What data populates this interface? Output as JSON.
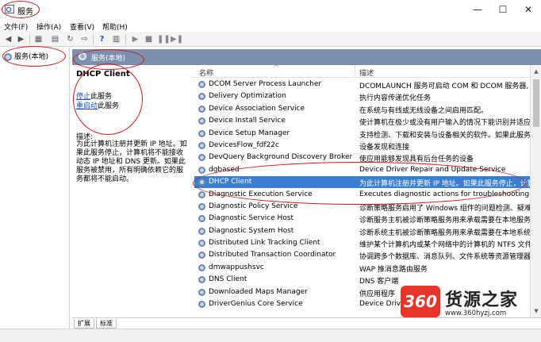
{
  "window": {
    "title": "服务",
    "controls": {
      "minimize": "—",
      "maximize": "☐",
      "close": "✕"
    }
  },
  "menu": {
    "items": [
      "文件(F)",
      "操作(A)",
      "查看(V)",
      "帮助(H)"
    ]
  },
  "tree": {
    "root_label": "服务(本地)"
  },
  "panel": {
    "header": "服务(本地)"
  },
  "description": {
    "service_name": "DHCP Client",
    "stop_link": "停止",
    "stop_suffix": "此服务",
    "restart_link": "重启动",
    "restart_suffix": "此服务",
    "label": "描述:",
    "text": "为此计算机注册并更新 IP 地址。如果此服务停止，计算机将不能接收动态 IP 地址和 DNS 更新。如果此服务被禁用，所有明确依赖它的服务都将不能启动。"
  },
  "list": {
    "columns": {
      "name": "名称",
      "description": "描述",
      "sort_indicator": "^"
    },
    "rows": [
      {
        "name": "DCOM Server Process Launcher",
        "info": "DCOMLAUNCH 服务可启动 COM 和 DCOM 服务器,",
        "selected": false
      },
      {
        "name": "Delivery Optimization",
        "info": "执行内容传递优化任务",
        "selected": false
      },
      {
        "name": "Device Association Service",
        "info": "在系统与有线或无线设备之间启用匹配。",
        "selected": false
      },
      {
        "name": "Device Install Service",
        "info": "使计算机在极少或没有用户输入的情况下能识别并适应硬",
        "selected": false
      },
      {
        "name": "Device Setup Manager",
        "info": "支持检测、下载和安装与设备相关的软件。如果此服务被",
        "selected": false
      },
      {
        "name": "DevicesFlow_fdf22c",
        "info": "设备发现和连接",
        "selected": false
      },
      {
        "name": "DevQuery Background Discovery Broker",
        "info": "使应用能够发现具有后台任务的设备",
        "selected": false
      },
      {
        "name": "dgbased",
        "info": "Device Driver Repair and Update Service",
        "selected": false
      },
      {
        "name": "DHCP Client",
        "info": "为此计算机注册并更新 IP 地址。如果此服务停止，计算",
        "selected": true
      },
      {
        "name": "Diagnostic Execution Service",
        "info": "Executes diagnostic actions for troubleshooting su",
        "selected": false
      },
      {
        "name": "Diagnostic Policy Service",
        "info": "诊断策略服务启用了 Windows 组件的问题检测、疑难解",
        "selected": false
      },
      {
        "name": "Diagnostic Service Host",
        "info": "诊断服务主机被诊断策略服务用来承载需要在本地服务",
        "selected": false
      },
      {
        "name": "Diagnostic System Host",
        "info": "诊断系统主机被诊断策略服务用来承载需要在本地系统",
        "selected": false
      },
      {
        "name": "Distributed Link Tracking Client",
        "info": "维护某个计算机内或某个网络中的计算机的 NTFS 文件之",
        "selected": false
      },
      {
        "name": "Distributed Transaction Coordinator",
        "info": "协调跨多个数据库、消息队列、文件系统等资源管理器的",
        "selected": false
      },
      {
        "name": "dmwappushsvc",
        "info": "WAP 推消息路由服务",
        "selected": false
      },
      {
        "name": "DNS Client",
        "info": "DNS 客户端",
        "selected": false
      },
      {
        "name": "Downloaded Maps Manager",
        "info": "供应用程序",
        "selected": false
      },
      {
        "name": "DriverGenius Core Service",
        "info": "Device Drive",
        "selected": false
      }
    ]
  },
  "tabs": {
    "extended": "扩展",
    "standard": "标准"
  },
  "watermark": {
    "logo": "360",
    "brand": "货源之家",
    "url": "www.360hyzj.com"
  },
  "colors": {
    "selection": "#3a7fd1",
    "panel_header": "#7c8fae",
    "annotation": "#d01818",
    "watermark_red": "#e8352b"
  }
}
